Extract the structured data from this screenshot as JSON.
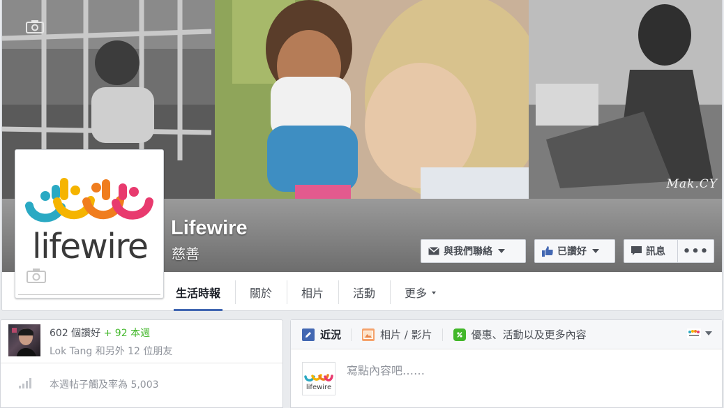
{
  "page": {
    "name": "Lifewire",
    "category": "慈善",
    "logo_text": "lifewire",
    "cover_watermark": "Mak.CY"
  },
  "cover_actions": {
    "contact_label": "與我們聯絡",
    "liked_label": "已讚好",
    "message_label": "訊息",
    "more_label": "•••"
  },
  "tabs": [
    {
      "label": "生活時報",
      "active": true
    },
    {
      "label": "關於",
      "active": false
    },
    {
      "label": "相片",
      "active": false
    },
    {
      "label": "活動",
      "active": false
    },
    {
      "label": "更多",
      "active": false
    }
  ],
  "likes": {
    "count_text": "602 個讚好",
    "weekly_text": "+ 92 本週",
    "friends_text": "Lok Tang 和另外 12 位朋友"
  },
  "reach": {
    "text": "本週帖子觸及率為 5,003"
  },
  "composer": {
    "tabs": [
      {
        "label": "近況",
        "icon": "pencil-icon",
        "active": true
      },
      {
        "label": "相片 / 影片",
        "icon": "photo-icon",
        "active": false
      },
      {
        "label": "優惠、活動以及更多內容",
        "icon": "offer-icon",
        "active": false
      }
    ],
    "placeholder": "寫點內容吧……"
  },
  "colors": {
    "accent": "#4267b2",
    "positive": "#42b72a",
    "logo_teal": "#2aa9c3",
    "logo_yellow": "#f5b400",
    "logo_orange": "#f07d1e",
    "logo_pink": "#e83a6e"
  }
}
